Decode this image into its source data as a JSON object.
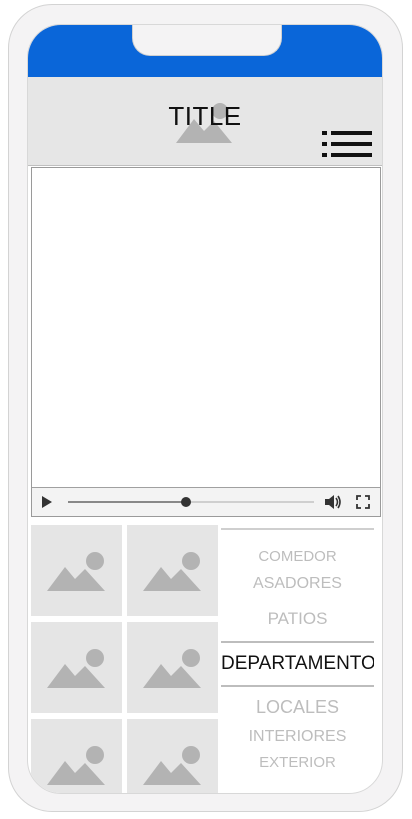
{
  "header": {
    "title": "TITLE"
  },
  "video": {
    "progress": 0.48
  },
  "gallery": {
    "thumbnail_count": 6
  },
  "categories": {
    "items": [
      {
        "label": "COMEDOR"
      },
      {
        "label": "ASADORES"
      },
      {
        "label": "PATIOS"
      },
      {
        "label": "DEPARTAMENTOS"
      },
      {
        "label": "LOCALES"
      },
      {
        "label": "INTERIORES"
      },
      {
        "label": "EXTERIOR"
      }
    ],
    "active_index": 3
  },
  "colors": {
    "status_bar": "#0a66d9",
    "header_bg": "#e6e6e6",
    "placeholder_bg": "#e5e5e5",
    "placeholder_icon": "#b3b3b3"
  },
  "icons": [
    "image-placeholder-icon",
    "hamburger-menu-icon",
    "play-icon",
    "volume-icon",
    "fullscreen-icon"
  ]
}
